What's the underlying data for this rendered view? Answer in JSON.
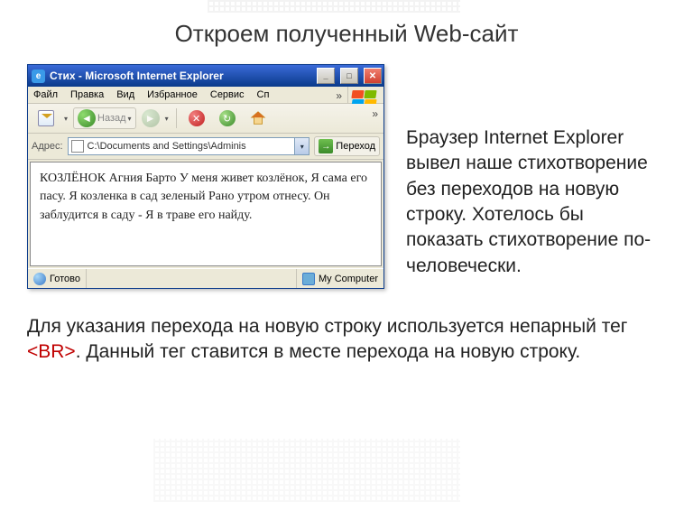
{
  "heading": "Откроем полученный Web-сайт",
  "side_text": "Браузер Internet Explorer вывел наше стихотворение без переходов на новую строку. Хотелось бы показать стихотворение по-человечески.",
  "bottom_text_1": "Для указания перехода на новую строку используется непарный тег ",
  "bottom_tag": "<BR>",
  "bottom_text_2": ". Данный тег ставится в месте перехода на новую строку.",
  "ie": {
    "title": "Стих - Microsoft Internet Explorer",
    "menu": {
      "file": "Файл",
      "edit": "Правка",
      "view": "Вид",
      "favorites": "Избранное",
      "service": "Сервис",
      "help_cut": "Сп"
    },
    "toolbar": {
      "back": "Назад"
    },
    "address": {
      "label": "Адрес:",
      "value": "C:\\Documents and Settings\\Adminis",
      "go": "Переход"
    },
    "content": "КОЗЛЁНОК Агния Барто У меня живет козлёнок, Я сама его пасу. Я козленка в сад зеленый Рано утром отнесу. Он заблудится в саду - Я в траве его найду.",
    "status": {
      "ready": "Готово",
      "zone": "My Computer"
    }
  }
}
